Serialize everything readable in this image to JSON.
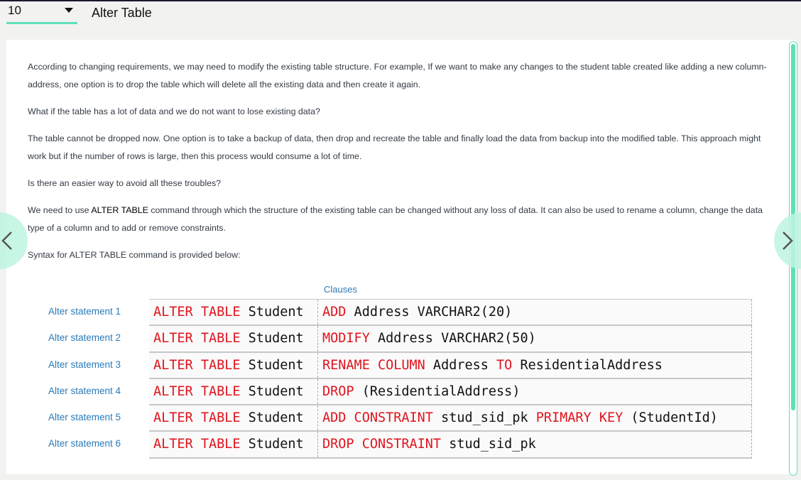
{
  "header": {
    "page_number": "10",
    "title": "Alter Table"
  },
  "content": {
    "paragraphs": [
      "According to changing requirements, we may need to modify the existing table structure. For example, If we want to make any changes to the student table created like adding a new column-address, one option is to drop the table which will delete all the existing data and then create it again.",
      "What if the table has a lot of data and we do not want to lose existing data?",
      "The table cannot be dropped now. One option is to take a backup of data, then drop and recreate the table and finally load the data from backup into the modified table. This approach might work but if the number of rows is large, then this process would consume a lot of time.",
      "Is there an easier way to avoid all these troubles?"
    ],
    "p5_before": "We need to use ",
    "p5_bold": "ALTER TABLE",
    "p5_after": " command through which the structure of the existing table can be changed without any loss of data. It can also be used to rename a column, change the data type of a column and to add or remove constraints.",
    "syntax_intro": "Syntax for ALTER TABLE command is provided below:"
  },
  "figure": {
    "clauses_label": "Clauses",
    "statement_labels": [
      "Alter statement 1",
      "Alter statement 2",
      "Alter statement 3",
      "Alter statement 4",
      "Alter statement 5",
      "Alter statement 6"
    ],
    "prefix_kw": "ALTER TABLE",
    "prefix_table": "Student",
    "rows": [
      [
        {
          "t": "ADD",
          "k": 1
        },
        {
          "t": " Address VARCHAR2(20)",
          "k": 0
        }
      ],
      [
        {
          "t": "MODIFY",
          "k": 1
        },
        {
          "t": " Address VARCHAR2(50)",
          "k": 0
        }
      ],
      [
        {
          "t": "RENAME COLUMN",
          "k": 1
        },
        {
          "t": " Address ",
          "k": 0
        },
        {
          "t": "TO",
          "k": 1
        },
        {
          "t": " ResidentialAddress",
          "k": 0
        }
      ],
      [
        {
          "t": "DROP",
          "k": 1
        },
        {
          "t": " (ResidentialAddress)",
          "k": 0
        }
      ],
      [
        {
          "t": "ADD CONSTRAINT",
          "k": 1
        },
        {
          "t": " stud_sid_pk ",
          "k": 0
        },
        {
          "t": "PRIMARY KEY",
          "k": 1
        },
        {
          "t": " (StudentId)",
          "k": 0
        }
      ],
      [
        {
          "t": "DROP CONSTRAINT",
          "k": 1
        },
        {
          "t": " stud_sid_pk",
          "k": 0
        }
      ]
    ]
  },
  "colors": {
    "accent": "#5fe0b8",
    "keyword": "#e0141e",
    "label": "#2a7ab8"
  },
  "icons": {
    "prev": "chevron-left-icon",
    "next": "chevron-right-icon",
    "dropdown": "caret-down-icon"
  }
}
